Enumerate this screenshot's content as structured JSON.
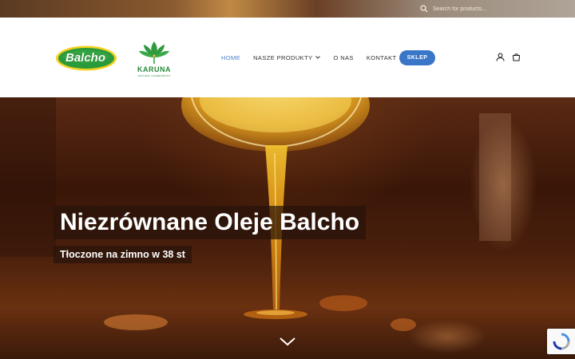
{
  "topbar": {
    "search_placeholder": "Search for products..."
  },
  "brand": {
    "balcho_logo_text": "Balcho",
    "karuna_logo_text": "KARUNA",
    "karuna_tagline": "NATURAL INGREDIENTS"
  },
  "nav": {
    "items": [
      {
        "label": "HOME",
        "active": true
      },
      {
        "label": "NASZE PRODUKTY",
        "has_dropdown": true
      },
      {
        "label": "O NAS"
      },
      {
        "label": "KONTAKT"
      }
    ],
    "shop_button": "SKLEP"
  },
  "icons": {
    "account": "user-icon",
    "cart": "shopping-bag-icon",
    "search": "search-icon",
    "scroll": "chevron-down-icon"
  },
  "hero": {
    "headline": "Niezrównane Oleje Balcho",
    "subheadline": "Tłoczone na zimno w 38 st"
  },
  "colors": {
    "accent": "#3a76c8",
    "active_nav": "#4a7fc8",
    "karuna_green": "#2a8a3a",
    "balcho_green": "#2a9a3a",
    "balcho_yellow": "#f5d020"
  }
}
